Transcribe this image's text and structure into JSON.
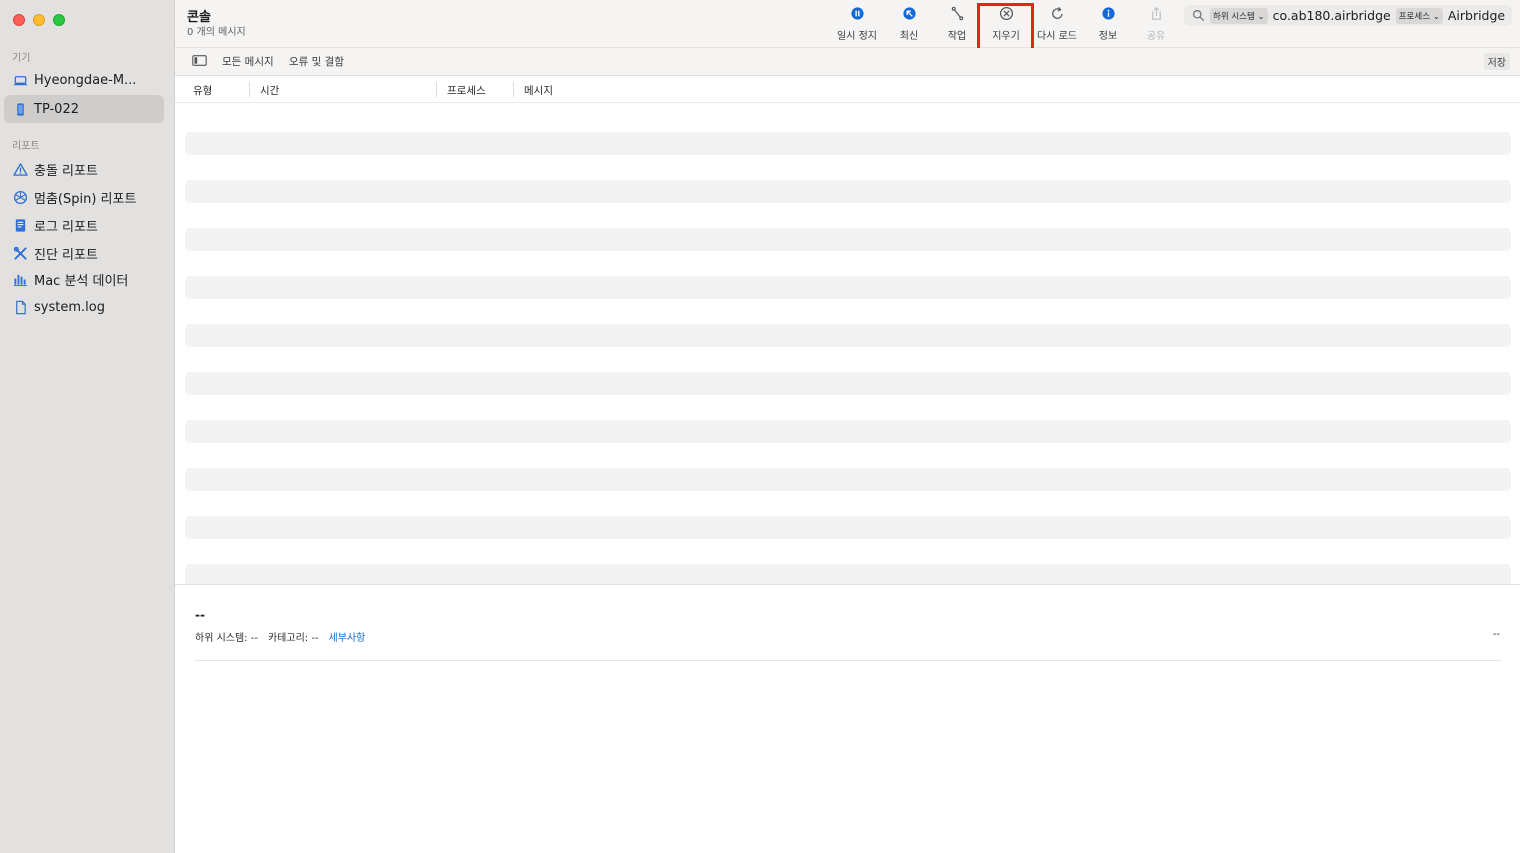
{
  "sidebar": {
    "section_devices": "기기",
    "devices": [
      {
        "label": "Hyeongdae-M...",
        "icon": "laptop-icon"
      },
      {
        "label": "TP-022",
        "icon": "phone-icon",
        "selected": true
      }
    ],
    "section_reports": "리포트",
    "reports": [
      {
        "label": "충돌 리포트",
        "icon": "warning-icon"
      },
      {
        "label": "멈춤(Spin) 리포트",
        "icon": "spin-icon"
      },
      {
        "label": "로그 리포트",
        "icon": "log-document-icon"
      },
      {
        "label": "진단 리포트",
        "icon": "tools-icon"
      },
      {
        "label": "Mac 분석 데이터",
        "icon": "bar-chart-icon"
      },
      {
        "label": "system.log",
        "icon": "file-icon"
      }
    ]
  },
  "toolbar": {
    "title": "콘솔",
    "subtitle": "0 개의 메시지",
    "tools": [
      {
        "label": "일시 정지",
        "icon": "pause-icon"
      },
      {
        "label": "최신",
        "icon": "arrow-up-left-icon"
      },
      {
        "label": "작업",
        "icon": "activity-icon"
      },
      {
        "label": "지우기",
        "icon": "clear-icon"
      },
      {
        "label": "다시 로드",
        "icon": "reload-icon"
      },
      {
        "label": "정보",
        "icon": "info-icon"
      },
      {
        "label": "공유",
        "icon": "share-icon",
        "disabled": true
      }
    ],
    "highlighted_tool": "지우기",
    "highlight_color": "#e8231a",
    "accent_color": "#1468d8"
  },
  "search": {
    "token1": "하위 시스템 ⌄",
    "value1": "co.ab180.airbridge",
    "token2": "프로세스 ⌄",
    "value2": "Airbridge"
  },
  "filter": {
    "all_messages": "모든 메시지",
    "errors_faults": "오류 및 결함",
    "save": "저장"
  },
  "columns": [
    "유형",
    "시간",
    "프로세스",
    "메시지"
  ],
  "detail": {
    "title": "--",
    "subsystem_label": "하위 시스템:",
    "subsystem_value": "--",
    "category_label": "카테고리:",
    "category_value": "--",
    "details_link": "세부사항",
    "right_value": "--"
  }
}
